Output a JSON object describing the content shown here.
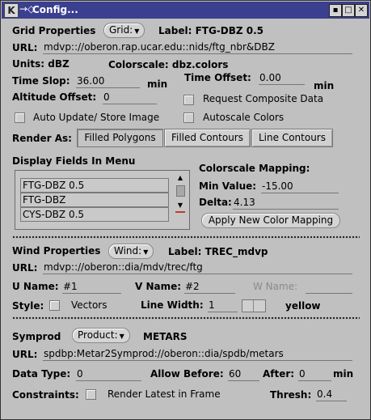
{
  "window": {
    "title": "Config...",
    "logo": "K",
    "arrow": "→◇",
    "buttons": [
      "▪",
      "□",
      "✕"
    ]
  },
  "grid": {
    "heading": "Grid Properties",
    "menu_label": "Grid:",
    "label": "Label: FTG-DBZ 0.5",
    "url_label": "URL:",
    "url": "mdvp:://oberon.rap.ucar.edu::nids/ftg_nbr&DBZ",
    "units": "Units: dBZ",
    "colorscale": "Colorscale: dbz.colors",
    "time_slop_label": "Time Slop:",
    "time_slop": "36.00",
    "time_slop_unit": "min",
    "time_offset_label": "Time Offset:",
    "time_offset": "0.00",
    "time_offset_unit": "min",
    "altitude_offset_label": "Altitude Offset:",
    "altitude_offset": "0",
    "request_composite": "Request Composite Data",
    "auto_update": "Auto Update/ Store Image",
    "autoscale": "Autoscale Colors",
    "render_as_label": "Render As:",
    "render_options": [
      "Filled Polygons",
      "Filled Contours",
      "Line Contours"
    ],
    "display_fields_label": "Display Fields In Menu",
    "display_fields": [
      "FTG-DBZ 0.5",
      "FTG-DBZ",
      "CYS-DBZ 0.5"
    ],
    "colorscale_mapping_label": "Colorscale Mapping:",
    "min_value_label": "Min Value:",
    "min_value": "-15.00",
    "delta_label": "Delta:",
    "delta": "4.13",
    "apply_button": "Apply New Color Mapping"
  },
  "wind": {
    "heading": "Wind Properties",
    "menu_label": "Wind:",
    "label": "Label: TREC_mdvp",
    "url_label": "URL:",
    "url": "mdvp:://oberon::dia/mdv/trec/ftg",
    "u_name_label": "U Name:",
    "u_name": "#1",
    "v_name_label": "V Name:",
    "v_name": "#2",
    "w_name_label": "W Name:",
    "w_name": "",
    "style_label": "Style:",
    "style_value": "Vectors",
    "line_width_label": "Line Width:",
    "line_width": "1",
    "color": "yellow"
  },
  "symprod": {
    "heading": "Symprod",
    "menu_label": "Product:",
    "product": "METARS",
    "url_label": "URL:",
    "url": "spdbp:Metar2Symprod://oberon::dia/spdb/metars",
    "data_type_label": "Data Type:",
    "data_type": "0",
    "allow_before_label": "Allow Before:",
    "allow_before": "60",
    "after_label": "After:",
    "after": "0",
    "after_unit": "min",
    "constraints_label": "Constraints:",
    "render_latest": "Render Latest in Frame",
    "thresh_label": "Thresh:",
    "thresh": "0.4"
  },
  "colors": {
    "titlebar": "#3b3f8f",
    "background": "#c0c0c0"
  }
}
